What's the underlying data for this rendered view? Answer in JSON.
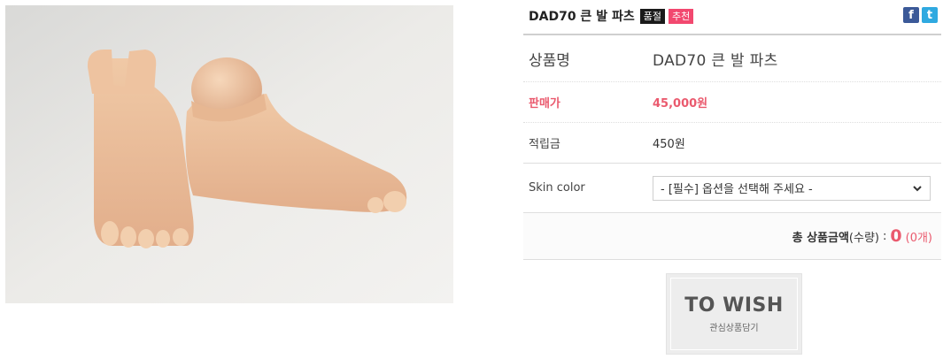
{
  "product": {
    "title": "DAD70 큰 발 파츠",
    "badges": {
      "soldout": "품절",
      "recommend": "추천"
    }
  },
  "share": {
    "facebook_icon": "facebook-icon",
    "twitter_icon": "twitter-icon",
    "facebook_glyph": "f",
    "twitter_glyph": "t"
  },
  "details": {
    "name_label": "상품명",
    "name_value": "DAD70 큰 발 파츠",
    "price_label": "판매가",
    "price_value": "45,000원",
    "points_label": "적립금",
    "points_value": "450원",
    "option_label": "Skin color",
    "option_selected": "- [필수] 옵션을 선택해 주세요 -"
  },
  "total": {
    "label": "총 상품금액",
    "sub_label": "(수량)",
    "separator": ":",
    "amount": "0",
    "count": "(0개)"
  },
  "wish": {
    "main": "TO WISH",
    "sub": "관심상품담기"
  },
  "colors": {
    "price": "#ea5a6e",
    "badge_soldout": "#1a1a1a",
    "badge_recommend": "#f2486f",
    "facebook": "#3b5998",
    "twitter": "#2fa9e0"
  }
}
